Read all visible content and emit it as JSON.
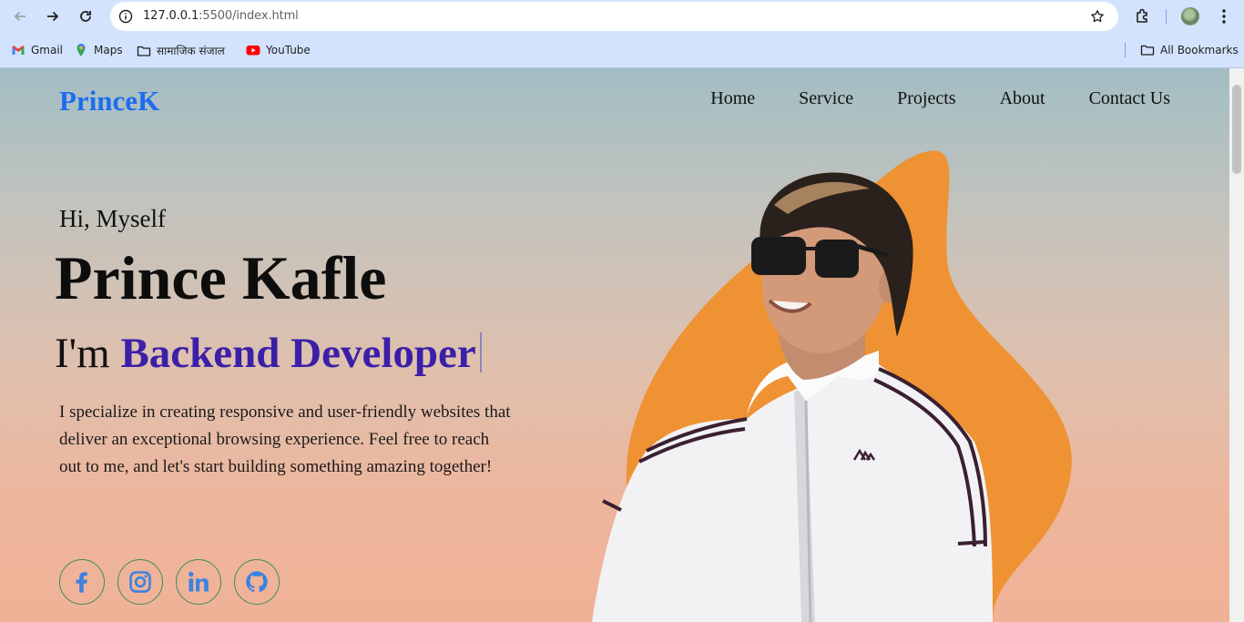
{
  "browser": {
    "url_host": "127.0.0.1",
    "url_path": ":5500/index.html",
    "bookmarks": [
      {
        "label": "Gmail",
        "icon": "gmail-icon"
      },
      {
        "label": "Maps",
        "icon": "maps-icon"
      },
      {
        "label": "सामाजिक संजाल",
        "icon": "folder-icon"
      },
      {
        "label": "YouTube",
        "icon": "youtube-icon"
      }
    ],
    "all_bookmarks": "All Bookmarks"
  },
  "site": {
    "logo": "PrinceK",
    "nav": [
      "Home",
      "Service",
      "Projects",
      "About",
      "Contact Us"
    ],
    "greeting": "Hi, Myself",
    "name": "Prince Kafle",
    "role_prefix": "I'm",
    "role_highlight": "Backend Developer",
    "bio": "I specialize in creating responsive and user-friendly websites that deliver an exceptional browsing experience. Feel free to reach out to me, and let's start building something amazing together!",
    "socials": [
      "facebook-icon",
      "instagram-icon",
      "linkedin-icon",
      "github-icon"
    ]
  },
  "colors": {
    "logo": "#1f6cf0",
    "role_highlight": "#3b1fa8",
    "social_icon": "#3b82e0",
    "social_border": "#3a8e5a",
    "blob": "#ee9234"
  }
}
